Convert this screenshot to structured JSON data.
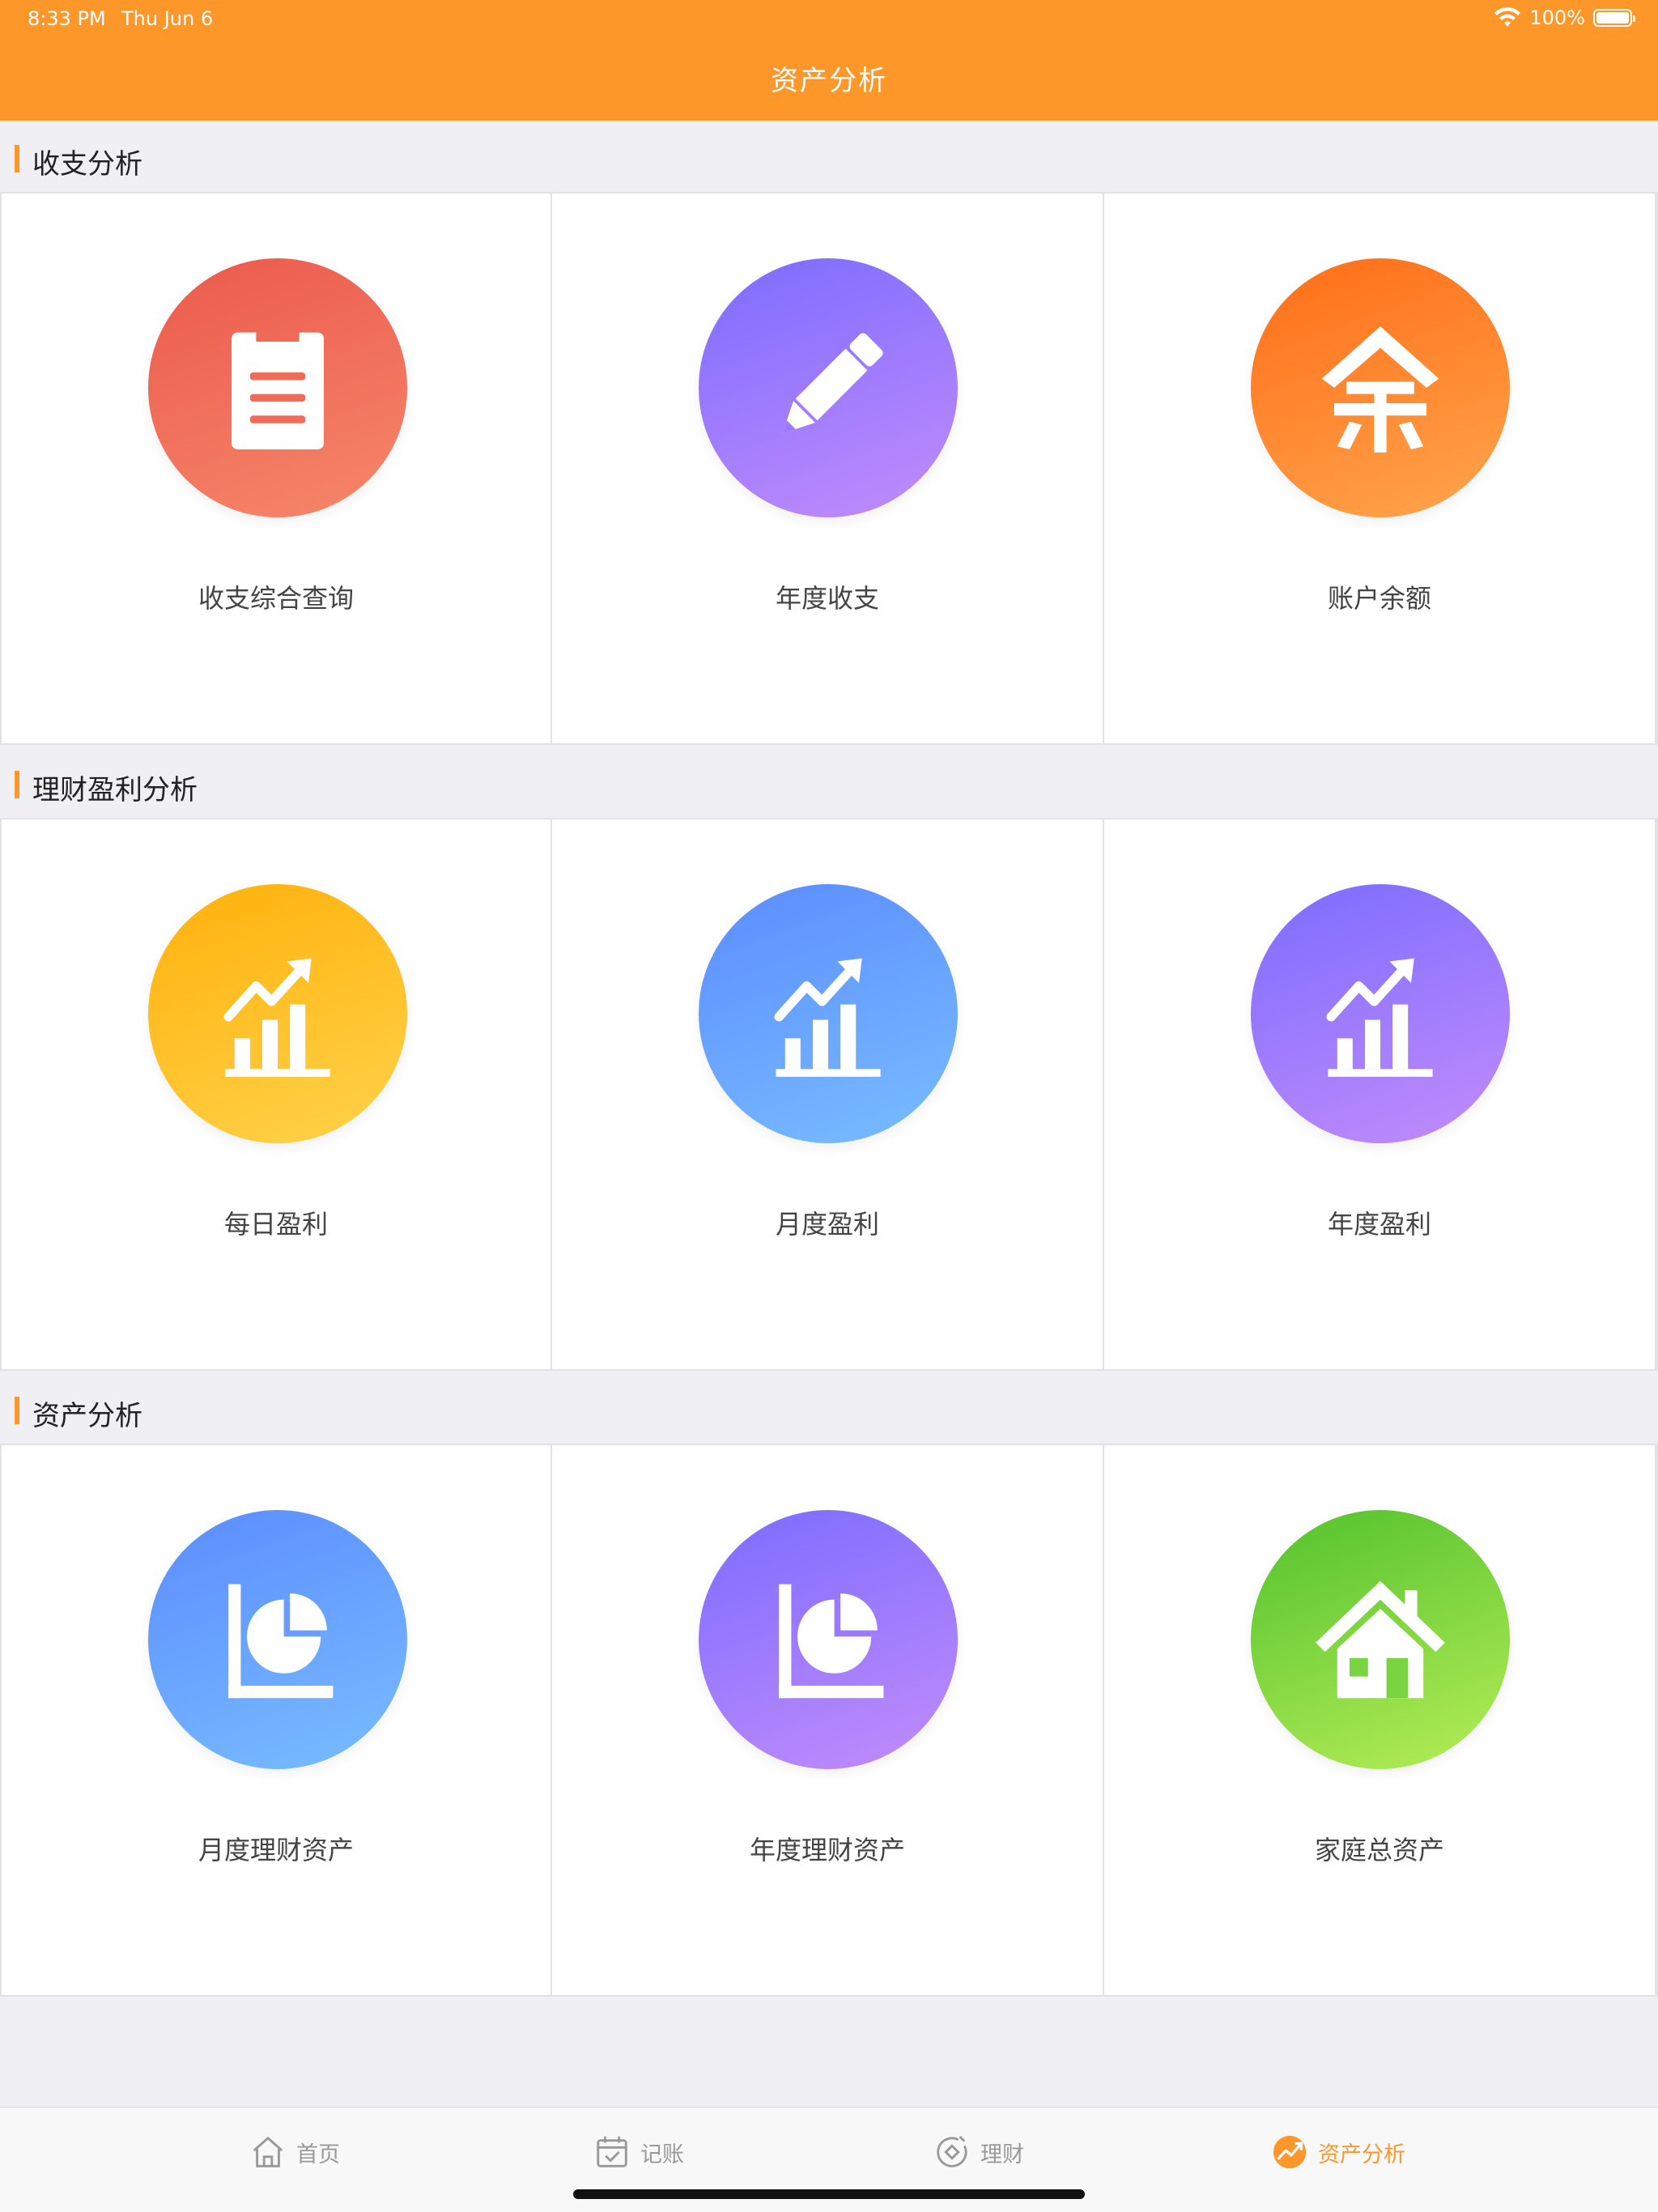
{
  "status": {
    "time": "8:33 PM",
    "date": "Thu Jun 6",
    "battery": "100%",
    "battery_level": 1.0
  },
  "header": {
    "title": "资产分析"
  },
  "sections": [
    {
      "title": "收支分析",
      "items": [
        {
          "label": "收支综合查询",
          "icon": "clipboard-icon",
          "color": "#eb5a4c"
        },
        {
          "label": "年度收支",
          "icon": "pencil-icon",
          "color": "#8a72fd"
        },
        {
          "label": "账户余额",
          "icon": "yu-char-icon",
          "color": "#ff7a22"
        }
      ]
    },
    {
      "title": "理财盈利分析",
      "items": [
        {
          "label": "每日盈利",
          "icon": "bar-chart-trend-icon",
          "color": "#ffbb1f"
        },
        {
          "label": "月度盈利",
          "icon": "bar-chart-trend-icon",
          "color": "#5f96ff"
        },
        {
          "label": "年度盈利",
          "icon": "bar-chart-trend-icon",
          "color": "#8a72fd"
        }
      ]
    },
    {
      "title": "资产分析",
      "items": [
        {
          "label": "月度理财资产",
          "icon": "pie-chart-icon",
          "color": "#5f96ff"
        },
        {
          "label": "年度理财资产",
          "icon": "pie-chart-icon",
          "color": "#8a72fd"
        },
        {
          "label": "家庭总资产",
          "icon": "house-icon",
          "color": "#68c935"
        }
      ]
    }
  ],
  "tabbar": {
    "items": [
      {
        "label": "首页",
        "icon": "home-icon"
      },
      {
        "label": "记账",
        "icon": "calendar-check-icon"
      },
      {
        "label": "理财",
        "icon": "coin-icon"
      },
      {
        "label": "资产分析",
        "icon": "analysis-icon"
      }
    ],
    "active_color": "#fe972a"
  }
}
